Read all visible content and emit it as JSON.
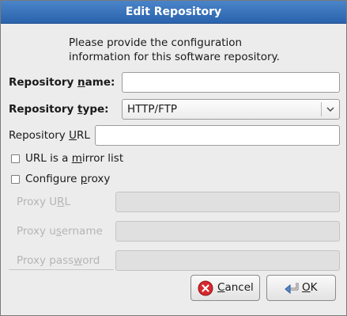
{
  "dialog": {
    "title": "Edit Repository",
    "intro": "Please provide the configuration information for this software repository."
  },
  "form": {
    "name": {
      "label_pre": "Repository ",
      "label_key": "n",
      "label_post": "ame:",
      "value": ""
    },
    "type": {
      "label_pre": "Repository ",
      "label_key": "t",
      "label_post": "ype:",
      "selected": "HTTP/FTP"
    },
    "url": {
      "label_pre": "Repository ",
      "label_key": "U",
      "label_post": "RL",
      "value": ""
    },
    "mirror": {
      "label_pre": "URL is a ",
      "label_key": "m",
      "label_post": "irror list",
      "checked": false
    },
    "proxy": {
      "label_pre": "Configure ",
      "label_key": "p",
      "label_post": "roxy",
      "checked": false
    },
    "proxy_url": {
      "label_pre": "Proxy U",
      "label_key": "R",
      "label_post": "L",
      "value": ""
    },
    "proxy_username": {
      "label_pre": "Proxy u",
      "label_key": "s",
      "label_post": "ername",
      "value": ""
    },
    "proxy_password": {
      "label_pre": "Proxy pass",
      "label_key": "w",
      "label_post": "ord",
      "value": ""
    }
  },
  "buttons": {
    "cancel": {
      "key": "C",
      "rest": "ancel",
      "icon": "cancel-icon"
    },
    "ok": {
      "key": "O",
      "rest": "K",
      "icon": "ok-icon"
    }
  },
  "colors": {
    "titlebar": "#2a63ad",
    "cancel_icon": "#d8272e"
  }
}
